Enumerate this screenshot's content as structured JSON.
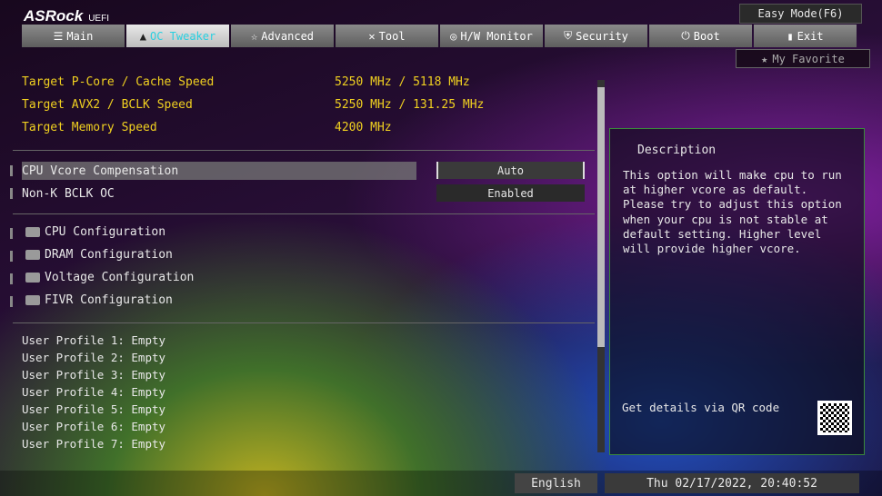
{
  "brand": {
    "name": "ASRock",
    "sub": "UEFI"
  },
  "tabs": [
    {
      "label": "Main",
      "icon": "list-icon"
    },
    {
      "label": "OC Tweaker",
      "icon": "rocket-icon"
    },
    {
      "label": "Advanced",
      "icon": "star-icon"
    },
    {
      "label": "Tool",
      "icon": "tools-icon"
    },
    {
      "label": "H/W Monitor",
      "icon": "monitor-icon"
    },
    {
      "label": "Security",
      "icon": "shield-icon"
    },
    {
      "label": "Boot",
      "icon": "power-icon"
    },
    {
      "label": "Exit",
      "icon": "door-icon"
    }
  ],
  "easy_mode": "Easy Mode(F6)",
  "favorite": "My Favorite",
  "targets": [
    {
      "label": "Target P-Core / Cache Speed",
      "value": "5250 MHz / 5118 MHz"
    },
    {
      "label": "Target AVX2 / BCLK Speed",
      "value": "5250 MHz / 131.25 MHz"
    },
    {
      "label": "Target Memory Speed",
      "value": "4200 MHz"
    }
  ],
  "settings": [
    {
      "label": "CPU Vcore Compensation",
      "value": "Auto"
    },
    {
      "label": "Non-K BCLK OC",
      "value": "Enabled"
    }
  ],
  "submenus": [
    "CPU Configuration",
    "DRAM Configuration",
    "Voltage Configuration",
    "FIVR Configuration"
  ],
  "profiles": [
    "User Profile 1: Empty",
    "User Profile 2: Empty",
    "User Profile 3: Empty",
    "User Profile 4: Empty",
    "User Profile 5: Empty",
    "User Profile 6: Empty",
    "User Profile 7: Empty"
  ],
  "description": {
    "title": "Description",
    "text": "This option will make cpu to run at higher vcore as default. Please try to adjust this option when your cpu is not stable at default setting. Higher level will provide higher vcore.",
    "qr_label": "Get details via QR code"
  },
  "footer": {
    "language": "English",
    "datetime": "Thu 02/17/2022, 20:40:52"
  }
}
